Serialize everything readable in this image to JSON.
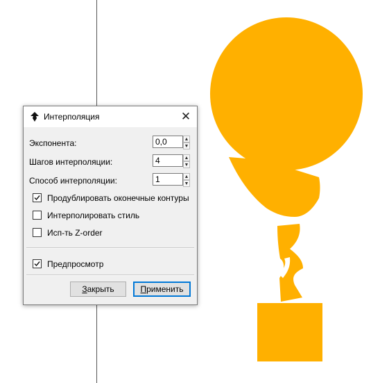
{
  "canvas": {
    "shape_color": "#FFB000",
    "guide_color": "#555555"
  },
  "dialog": {
    "title": "Интерполяция",
    "app_icon": "inkscape-icon",
    "close_icon": "close-icon",
    "close_glyph": "✕",
    "fields": {
      "exponent": {
        "label": "Экспонента:",
        "value": "0,0"
      },
      "steps": {
        "label": "Шагов интерполяции:",
        "value": "4"
      },
      "method": {
        "label": "Способ интерполяции:",
        "value": "1"
      }
    },
    "checkboxes": {
      "duplicate": {
        "label": "Продублировать оконечные контуры",
        "checked": true
      },
      "style": {
        "label": "Интерполировать стиль",
        "checked": false
      },
      "zorder": {
        "label": "Исп-ть Z-order",
        "checked": false
      },
      "preview": {
        "label": "Предпросмотр",
        "checked": true
      }
    },
    "buttons": {
      "close_first": "З",
      "close_rest": "акрыть",
      "apply_first": "П",
      "apply_rest": "рименить"
    },
    "spin_up": "▲",
    "spin_down": "▼"
  }
}
